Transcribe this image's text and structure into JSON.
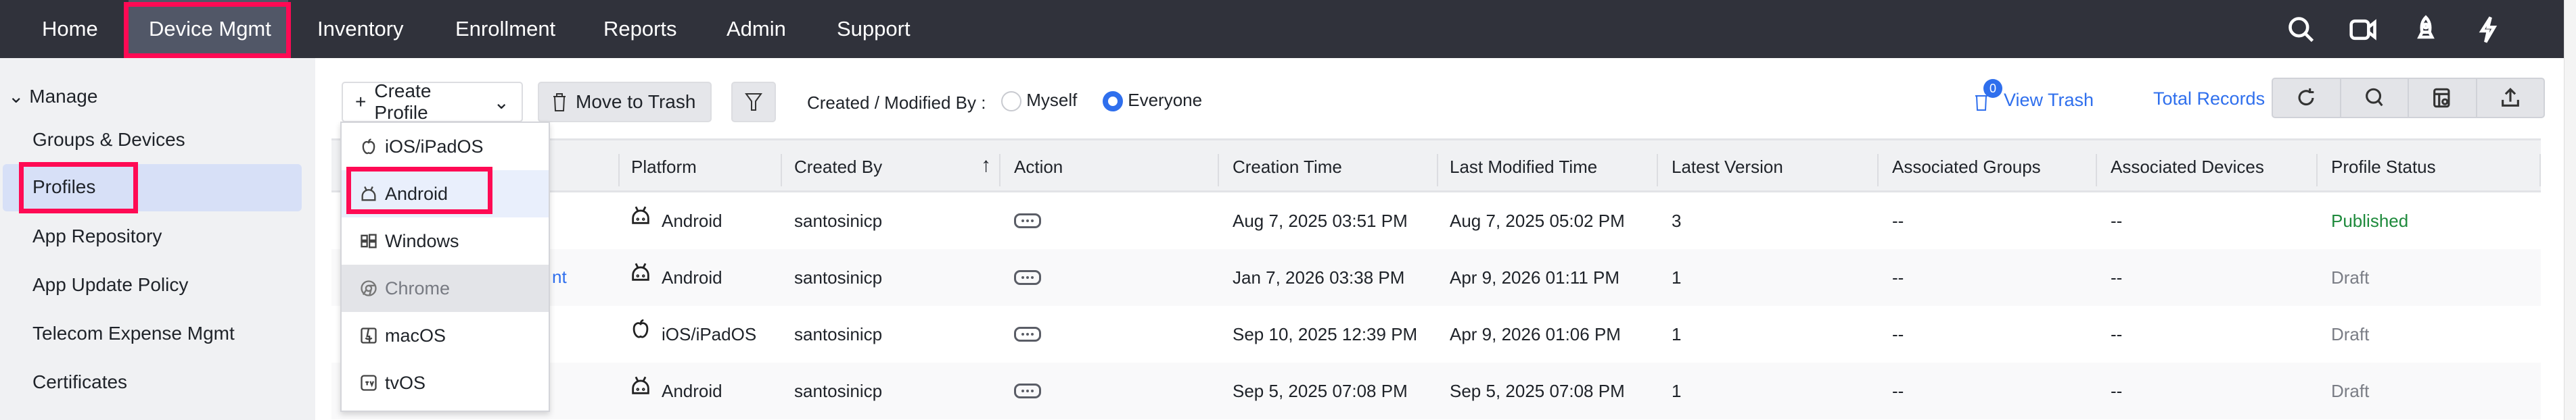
{
  "nav": {
    "items": [
      "Home",
      "Device Mgmt",
      "Inventory",
      "Enrollment",
      "Reports",
      "Admin",
      "Support"
    ],
    "active": "Device Mgmt"
  },
  "sidebar": {
    "section": "Manage",
    "items": [
      "Groups & Devices",
      "Profiles",
      "App Repository",
      "App Update Policy",
      "Telecom Expense Mgmt",
      "Certificates"
    ],
    "selected": "Profiles"
  },
  "toolbar": {
    "create_profile": "Create Profile",
    "move_to_trash": "Move to Trash",
    "filter_label": "Created / Modified By :",
    "radio_myself": "Myself",
    "radio_everyone": "Everyone",
    "selected_radio": "Everyone",
    "trash_count": "0",
    "view_trash": "View Trash",
    "total_records": "Total Records"
  },
  "dropdown": {
    "items": [
      {
        "label": "iOS/iPadOS",
        "icon": "apple-icon"
      },
      {
        "label": "Android",
        "icon": "android-icon",
        "highlighted": true
      },
      {
        "label": "Windows",
        "icon": "windows-icon"
      },
      {
        "label": "Chrome",
        "icon": "chrome-icon",
        "disabled": true
      },
      {
        "label": "macOS",
        "icon": "macos-icon"
      },
      {
        "label": "tvOS",
        "icon": "appletv-icon"
      }
    ]
  },
  "table": {
    "headers": [
      "Platform",
      "Created By",
      "Action",
      "Creation Time",
      "Last Modified Time",
      "Latest Version",
      "Associated Groups",
      "Associated Devices",
      "Profile Status"
    ],
    "partial_name": "nt",
    "rows": [
      {
        "platform": "Android",
        "created_by": "santosinicp",
        "creation": "Aug 7, 2025 03:51 PM",
        "modified": "Aug 7, 2025 05:02 PM",
        "version": "3",
        "groups": "--",
        "devices": "--",
        "status": "Published"
      },
      {
        "platform": "Android",
        "created_by": "santosinicp",
        "creation": "Jan 7, 2026 03:38 PM",
        "modified": "Apr 9, 2026 01:11 PM",
        "version": "1",
        "groups": "--",
        "devices": "--",
        "status": "Draft"
      },
      {
        "platform": "iOS/iPadOS",
        "created_by": "santosinicp",
        "creation": "Sep 10, 2025 12:39 PM",
        "modified": "Apr 9, 2026 01:06 PM",
        "version": "1",
        "groups": "--",
        "devices": "--",
        "status": "Draft"
      },
      {
        "platform": "Android",
        "created_by": "santosinicp",
        "creation": "Sep 5, 2025 07:08 PM",
        "modified": "Sep 5, 2025 07:08 PM",
        "version": "1",
        "groups": "--",
        "devices": "--",
        "status": "Draft"
      }
    ]
  },
  "colors": {
    "accent": "#2f6fed",
    "published": "#1e8a3c",
    "draft": "#7a7d85",
    "highlight": "#ff0a54"
  }
}
